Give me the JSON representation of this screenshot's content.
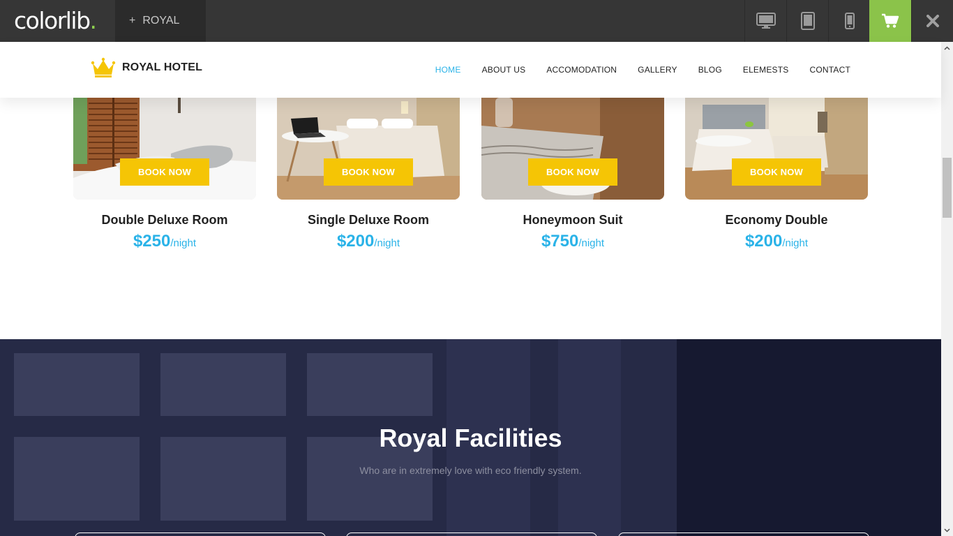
{
  "colorlib_bar": {
    "logo_text": "colorlib",
    "logo_dot": ".",
    "tab_plus": "+",
    "tab_label": "ROYAL",
    "buttons": [
      "desktop-icon",
      "tablet-icon",
      "mobile-icon",
      "cart-icon",
      "close-icon"
    ],
    "cart_color": "#8bc34a"
  },
  "header": {
    "brand": "ROYAL HOTEL",
    "crown_color": "#f5c505",
    "nav": [
      {
        "label": "HOME",
        "active": true
      },
      {
        "label": "ABOUT US",
        "active": false
      },
      {
        "label": "ACCOMODATION",
        "active": false
      },
      {
        "label": "GALLERY",
        "active": false
      },
      {
        "label": "BLOG",
        "active": false
      },
      {
        "label": "ELEMESTS",
        "active": false
      },
      {
        "label": "CONTACT",
        "active": false
      }
    ],
    "accent_color": "#2bb3e8"
  },
  "rooms": [
    {
      "name": "Double Deluxe Room",
      "price": "$250",
      "unit": "/night",
      "button": "BOOK NOW"
    },
    {
      "name": "Single Deluxe Room",
      "price": "$200",
      "unit": "/night",
      "button": "BOOK NOW"
    },
    {
      "name": "Honeymoon Suit",
      "price": "$750",
      "unit": "/night",
      "button": "BOOK NOW"
    },
    {
      "name": "Economy Double",
      "price": "$200",
      "unit": "/night",
      "button": "BOOK NOW"
    }
  ],
  "facilities": {
    "title": "Royal Facilities",
    "subtitle": "Who are in extremely love with eco friendly system."
  },
  "colors": {
    "book_button": "#f5c505",
    "price": "#2bb3e8",
    "facilities_bg": "#1a1d33"
  }
}
